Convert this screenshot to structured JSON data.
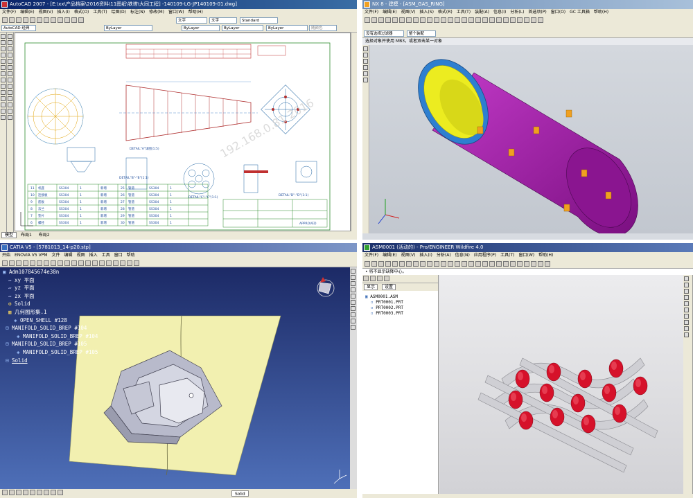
{
  "autocad": {
    "title": "AutoCAD 2007 - [E:\\xx\\产品档案\\2016资料\\11图纸\\铁塔\\大同工程] -140109-LG-JP140109-01.dwg]",
    "menus": [
      "文件(F)",
      "编辑(E)",
      "视图(V)",
      "插入(I)",
      "格式(O)",
      "工具(T)",
      "绘图(D)",
      "标注(N)",
      "修改(M)",
      "窗口(W)",
      "帮助(H)"
    ],
    "workspace": "AutoCAD 经典",
    "layer": "ByLayer",
    "textstyle": "文字",
    "dimstyle": "Standard",
    "color_ctrl": "ByLayer",
    "linetype_ctrl": "ByLayer",
    "lineweight_ctrl": "ByLayer",
    "plotstyle": "随颜色",
    "tabs": [
      "模型",
      "布局1",
      "布局2"
    ],
    "drawing": {
      "detail_labels": [
        "DETAIL\"A\"详图(1:5)",
        "DETAIL\"C\"-\"C\"(1:1)",
        "DETAIL\"D\"-\"D\"(1:1)",
        "DETAIL\"B\"-\"B\"(1:1)"
      ],
      "titleblock_text": "APPROVED",
      "watermark": "192.168.0.81 2016"
    },
    "bom_rows": [
      [
        "11",
        "机座",
        "SS304",
        "1",
        "",
        "新增",
        "25",
        "管道",
        "SS304",
        "1"
      ],
      [
        "10",
        "连接板",
        "SS304",
        "1",
        "",
        "新增",
        "26",
        "管道",
        "SS304",
        "1"
      ],
      [
        "9",
        "底板",
        "SS304",
        "1",
        "",
        "新增",
        "27",
        "管道",
        "SS304",
        "1"
      ],
      [
        "8",
        "法兰",
        "SS304",
        "1",
        "",
        "新增",
        "28",
        "管道",
        "SS304",
        "1"
      ],
      [
        "7",
        "垫片",
        "SS304",
        "1",
        "",
        "新增",
        "29",
        "管道",
        "SS304",
        "1"
      ],
      [
        "6",
        "螺栓",
        "SS304",
        "1",
        "",
        "新增",
        "30",
        "管道",
        "SS304",
        "1"
      ]
    ]
  },
  "nx": {
    "title": "NX 8 - 建模 - [ASM_GAS_RING]",
    "menus": [
      "文件(F)",
      "编辑(E)",
      "视图(V)",
      "插入(S)",
      "格式(R)",
      "工具(T)",
      "装配(A)",
      "信息(I)",
      "分析(L)",
      "首选项(P)",
      "窗口(O)",
      "GC 工具箱",
      "帮助(H)"
    ],
    "filter": "没有选择过滤器",
    "assembly_filter": "整个装配",
    "cue": "选择对象并使用 MB3，或者双击某一对象",
    "colors": {
      "shell": "#a01aa6",
      "inner": "#ecec20",
      "rim": "#2e7fd0",
      "lug": "#f0a020",
      "bg": "#cfd3d8"
    }
  },
  "catia": {
    "title": "CATIA V5 - [5781013_14-p20.stp]",
    "menus": [
      "开始",
      "ENOVIA V5 VPM",
      "文件",
      "编辑",
      "视图",
      "插入",
      "工具",
      "窗口",
      "帮助"
    ],
    "tree": [
      "Adm107845674e38n",
      "xy 平面",
      "yz 平面",
      "zx 平面",
      "Solid",
      "几何图形集.1",
      "OPEN_SHELL #128",
      "MANIFOLD_SOLID_BREP #104",
      "MANIFOLD_SOLID_BREP #104",
      "MANIFOLD_SOLID_BREP #105",
      "MANIFOLD_SOLID_BREP #105",
      "Solid"
    ],
    "status_label": "Solid",
    "colors": {
      "bg_top": "#1c2a66",
      "bg_bottom": "#4e6fb8",
      "sheet": "#f2f0b0",
      "part": "#c8cad8"
    }
  },
  "proe": {
    "title": "ASM0001 (活动的) - Pro/ENGINEER Wildfire 4.0",
    "menus": [
      "文件(F)",
      "编辑(E)",
      "视图(V)",
      "插入(I)",
      "分析(A)",
      "信息(N)",
      "应用程序(P)",
      "工具(T)",
      "窗口(W)",
      "帮助(H)"
    ],
    "message": "• 将不显示缺降中心。",
    "tabs": [
      "显示",
      "设置"
    ],
    "tree": [
      "ASM0001.ASM",
      "PRT0001.PRT",
      "PRT0002.PRT",
      "PRT0003.PRT"
    ],
    "colors": {
      "roller": "#d6112a",
      "bar": "#c8c8cc",
      "bg": "#e2e2e4"
    }
  }
}
